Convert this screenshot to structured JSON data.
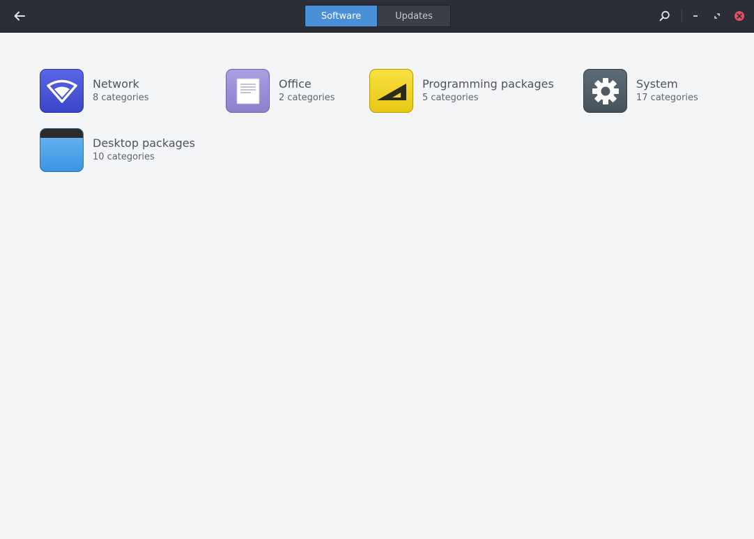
{
  "header": {
    "tabs": [
      {
        "label": "Software",
        "active": true
      },
      {
        "label": "Updates",
        "active": false
      }
    ],
    "icons": {
      "back": "back-arrow-icon",
      "search": "search-icon",
      "minimize": "minimize-icon",
      "maximize": "maximize-icon",
      "close": "close-icon"
    }
  },
  "categories": [
    {
      "title": "Network",
      "subtitle": "8 categories",
      "icon": "network-icon"
    },
    {
      "title": "Office",
      "subtitle": "2 categories",
      "icon": "office-icon"
    },
    {
      "title": "Programming packages",
      "subtitle": "5 categories",
      "icon": "programming-icon"
    },
    {
      "title": "System",
      "subtitle": "17 categories",
      "icon": "system-icon"
    },
    {
      "title": "Desktop packages",
      "subtitle": "10 categories",
      "icon": "desktop-icon"
    }
  ],
  "colors": {
    "accent": "#4a90d9",
    "headerbar": "#2b2e36",
    "background": "#f3f5f7",
    "close": "#e0535e"
  }
}
